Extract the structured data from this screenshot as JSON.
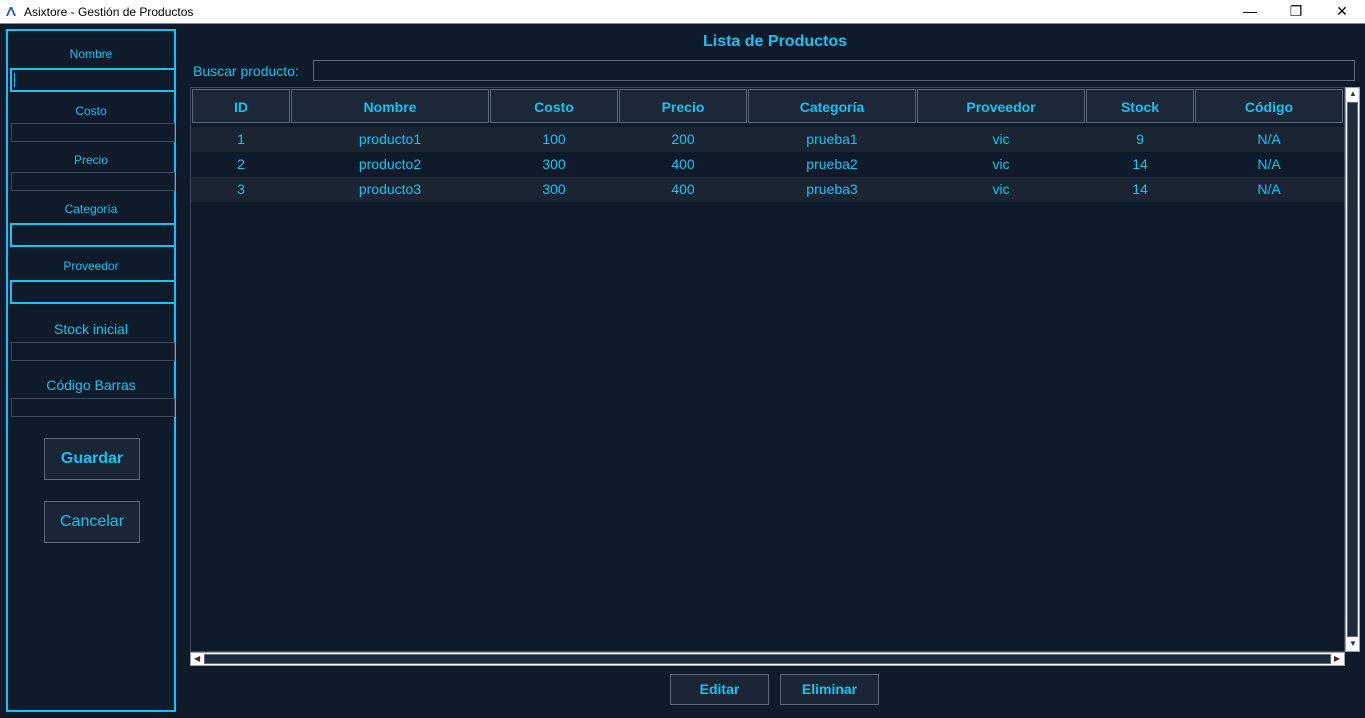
{
  "window": {
    "title": "Asixtore - Gestión de Productos",
    "minimize": "—",
    "maximize": "❐",
    "close": "✕"
  },
  "form": {
    "nombre_label": "Nombre",
    "costo_label": "Costo",
    "precio_label": "Precio",
    "categoria_label": "Categoría",
    "proveedor_label": "Proveedor",
    "stock_label": "Stock inicial",
    "codigo_label": "Código Barras",
    "guardar": "Guardar",
    "cancelar": "Cancelar"
  },
  "main": {
    "title": "Lista de Productos",
    "search_label": "Buscar producto:",
    "columns": [
      "ID",
      "Nombre",
      "Costo",
      "Precio",
      "Categoría",
      "Proveedor",
      "Stock",
      "Código"
    ],
    "rows": [
      [
        "1",
        "producto1",
        "100",
        "200",
        "prueba1",
        "vic",
        "9",
        "N/A"
      ],
      [
        "2",
        "producto2",
        "300",
        "400",
        "prueba2",
        "vic",
        "14",
        "N/A"
      ],
      [
        "3",
        "producto3",
        "300",
        "400",
        "prueba3",
        "vic",
        "14",
        "N/A"
      ]
    ],
    "edit": "Editar",
    "delete": "Eliminar"
  },
  "colors": {
    "accent": "#19c3f0",
    "background": "#0f1a2b"
  }
}
